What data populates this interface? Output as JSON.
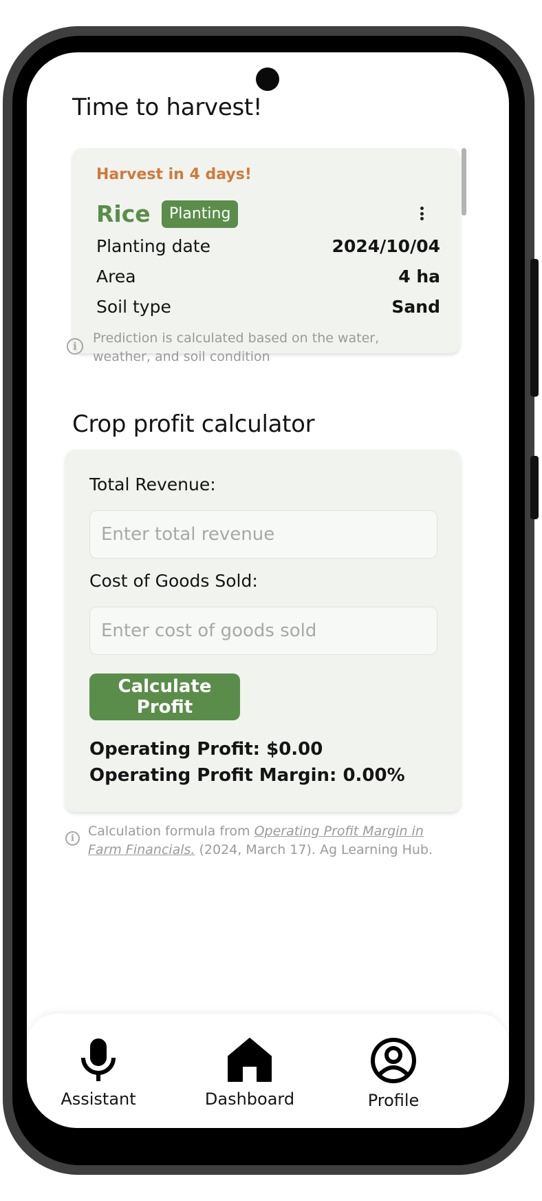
{
  "harvest_section": {
    "title": "Time to harvest!",
    "card": {
      "alert": "Harvest in 4 days!",
      "crop": "Rice",
      "status_badge": "Planting",
      "details": [
        {
          "label": "Planting date",
          "value": "2024/10/04"
        },
        {
          "label": "Area",
          "value": "4 ha"
        },
        {
          "label": "Soil type",
          "value": "Sand"
        }
      ]
    },
    "note": "Prediction is calculated based on the water, weather, and soil condition"
  },
  "calculator_section": {
    "title": "Crop profit calculator",
    "revenue_label": "Total Revenue:",
    "revenue_placeholder": "Enter total revenue",
    "cogs_label": "Cost of Goods Sold:",
    "cogs_placeholder": "Enter cost of goods sold",
    "button_label": "Calculate Profit",
    "operating_profit": "Operating Profit: $0.00",
    "operating_margin": "Operating Profit Margin: 0.00%",
    "note_prefix": "Calculation formula from ",
    "note_link": "Operating Profit Margin in Farm Financials.",
    "note_suffix": " (2024, March 17). Ag Learning Hub."
  },
  "bottom_nav": [
    {
      "label": "Assistant",
      "icon": "microphone-icon"
    },
    {
      "label": "Dashboard",
      "icon": "home-icon"
    },
    {
      "label": "Profile",
      "icon": "account-circle-icon"
    }
  ],
  "colors": {
    "accent_green": "#5a8d4a",
    "alert_orange": "#d07a3c",
    "card_background": "#f1f3ef"
  }
}
